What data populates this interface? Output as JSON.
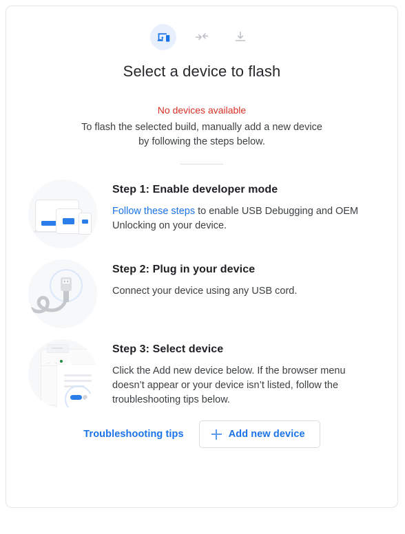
{
  "header": {
    "icons": [
      {
        "name": "devices-icon",
        "active": true
      },
      {
        "name": "connect-arrows-icon",
        "active": false
      },
      {
        "name": "download-icon",
        "active": false
      }
    ],
    "title": "Select a device to flash"
  },
  "intro": {
    "error": "No devices available",
    "description": "To flash the selected build, manually add a new device by following the steps below."
  },
  "steps": [
    {
      "art": "devices-illustration",
      "title": "Step 1: Enable developer mode",
      "link_text": "Follow these steps",
      "text_after_link": " to enable USB Debugging and OEM Unlocking on your device."
    },
    {
      "art": "usb-cable-illustration",
      "title": "Step 2: Plug in your device",
      "text": "Connect your device using any USB cord."
    },
    {
      "art": "browser-select-illustration",
      "title": "Step 3: Select device",
      "text": "Click the Add new device below. If the browser menu doesn’t appear or your device isn’t listed, follow the troubleshooting tips below."
    }
  ],
  "footer": {
    "troubleshooting_label": "Troubleshooting tips",
    "add_device_label": "Add new device",
    "add_device_icon": "plus-icon"
  },
  "colors": {
    "link_blue": "#1a73e8",
    "accent_blue": "#2b7de9",
    "error_red": "#d93025",
    "icon_circle_bg": "#e8f0fe",
    "art_circle_bg": "#f6f8fa",
    "border_gray": "#dadce0",
    "text_primary": "#202124",
    "text_secondary": "#3c4043"
  }
}
